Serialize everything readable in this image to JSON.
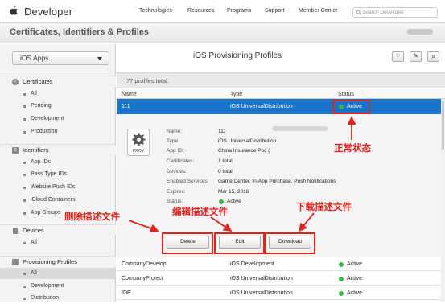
{
  "header": {
    "brand": "Developer",
    "nav": [
      "Technologies",
      "Resources",
      "Programs",
      "Support",
      "Member Center"
    ],
    "search_placeholder": "Search Developer"
  },
  "subheader": {
    "title": "Certificates, Identifiers & Profiles"
  },
  "sidebar": {
    "select_value": "iOS Apps",
    "sections": [
      {
        "title": "Certificates",
        "items": [
          "All",
          "Pending",
          "Development",
          "Production"
        ]
      },
      {
        "title": "Identifiers",
        "items": [
          "App IDs",
          "Pass Type IDs",
          "Website Push IDs",
          "iCloud Containers",
          "App Groups"
        ]
      },
      {
        "title": "Devices",
        "items": [
          "All"
        ]
      },
      {
        "title": "Provisioning Profiles",
        "items": [
          "All",
          "Development",
          "Distribution"
        ]
      }
    ]
  },
  "main": {
    "title": "iOS Provisioning Profiles",
    "toolbar": {
      "add": "+",
      "edit": "✎",
      "search": "⌕"
    },
    "count": "77 profiles total.",
    "columns": [
      "Name",
      "Type",
      "Status"
    ],
    "selected": {
      "name": "111",
      "type": "iOS UniversalDistribution",
      "status": "Active"
    },
    "detail": {
      "icon_label": "PROV",
      "labels": [
        "Name:",
        "Type:",
        "App ID:",
        "Certificates:",
        "Devices:",
        "Enabled Services:",
        "Expires:",
        "Status:"
      ],
      "values": [
        "111",
        "iOS UniversalDistribution",
        "China Insurance Poc (",
        "1 total",
        "0 total",
        "Game Center, In-App Purchase, Push Notifications",
        "Mar 15, 2016",
        "Active"
      ]
    },
    "buttons": {
      "delete": "Delete",
      "edit": "Edit",
      "download": "Download"
    },
    "rows": [
      {
        "name": "CompanyDevelop",
        "type": "iOS Development",
        "status": "Active"
      },
      {
        "name": "CompanyProject",
        "type": "iOS UniversalDistribution",
        "status": "Active"
      },
      {
        "name": "IDE",
        "type": "iOS UniversalDistribution",
        "status": "Active"
      }
    ]
  },
  "annotations": {
    "status": "正常状态",
    "delete": "删除描述文件",
    "edit": "编辑描述文件",
    "download": "下载描述文件"
  },
  "colors": {
    "annotation": "#e0231c",
    "selected_row": "#1a73c8",
    "active_dot": "#3bb54a"
  }
}
